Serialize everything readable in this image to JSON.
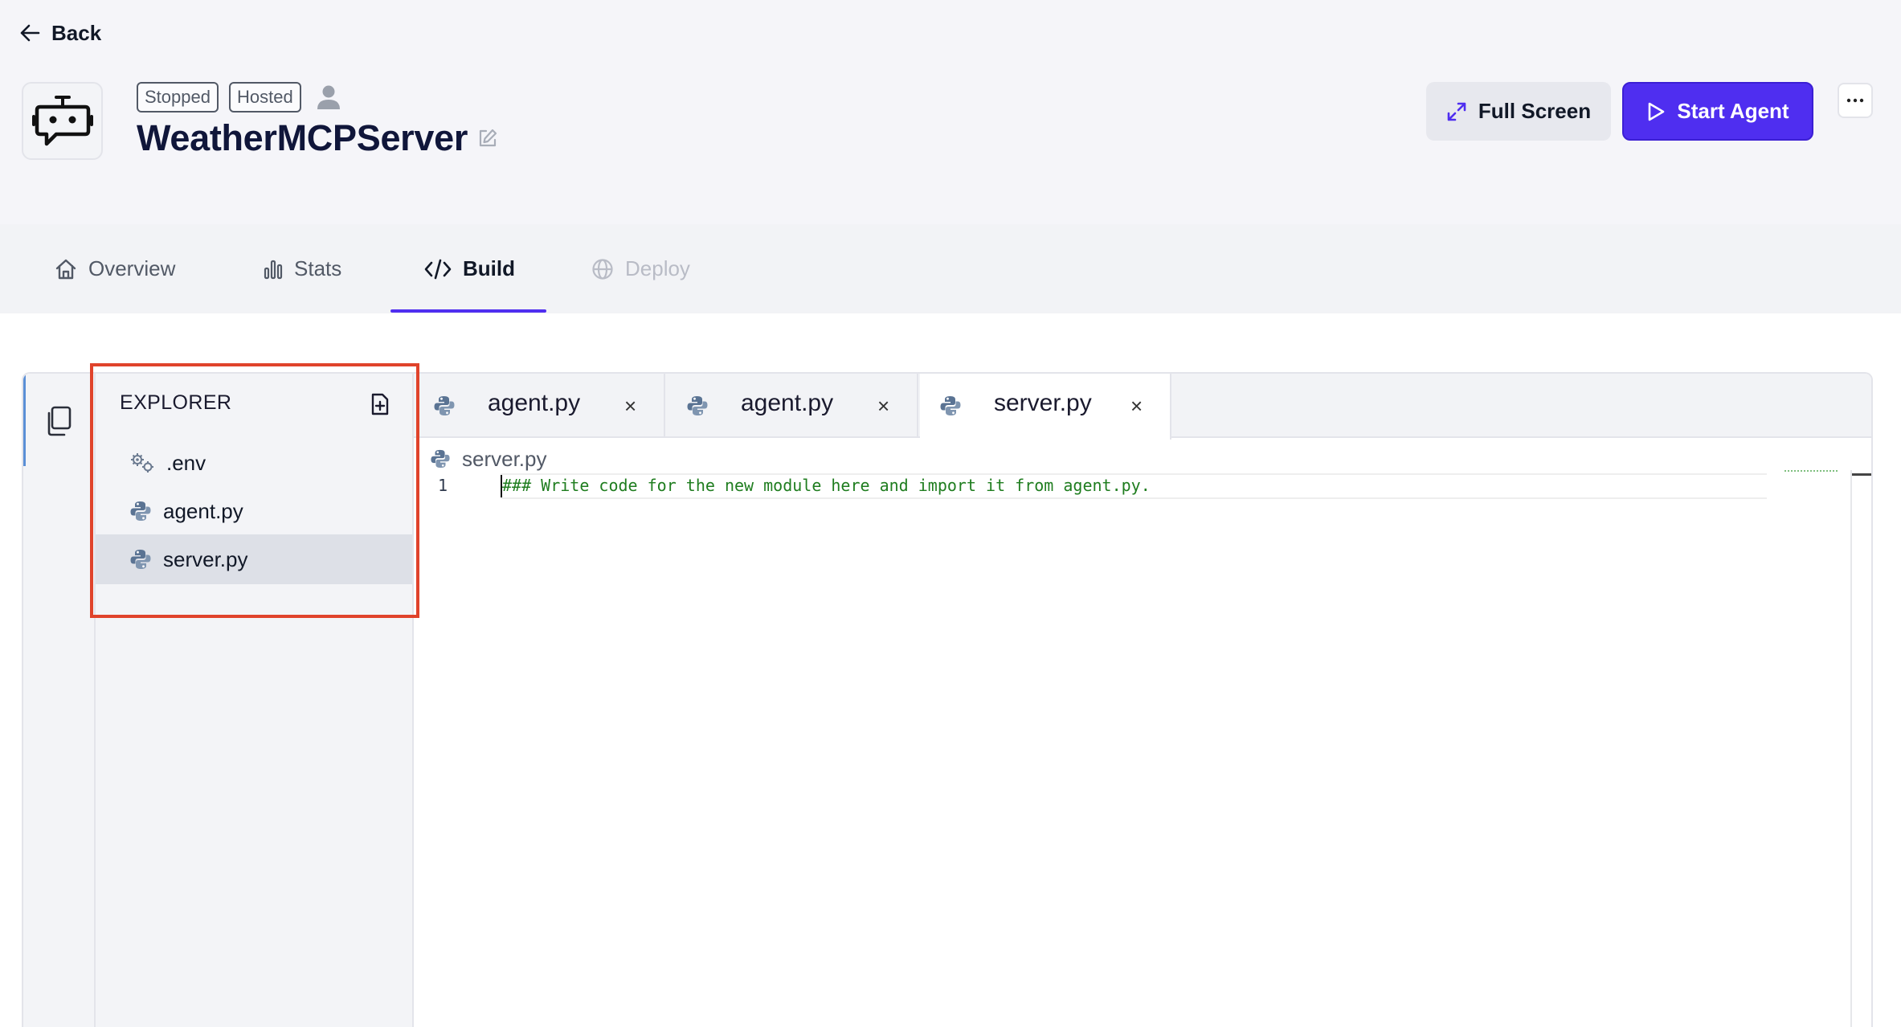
{
  "header": {
    "back_label": "Back",
    "badges": {
      "status": "Stopped",
      "hosting": "Hosted"
    },
    "agent_name": "WeatherMCPServer",
    "full_screen_label": "Full Screen",
    "start_agent_label": "Start Agent",
    "more_label": "···"
  },
  "tabs": [
    {
      "label": "Overview",
      "icon": "home-icon",
      "state": "normal"
    },
    {
      "label": "Stats",
      "icon": "bar-chart-icon",
      "state": "normal"
    },
    {
      "label": "Build",
      "icon": "code-icon",
      "state": "active"
    },
    {
      "label": "Deploy",
      "icon": "globe-icon",
      "state": "disabled"
    }
  ],
  "explorer": {
    "title": "EXPLORER",
    "files": [
      {
        "name": ".env",
        "icon": "gears-icon",
        "selected": false
      },
      {
        "name": "agent.py",
        "icon": "python-icon",
        "selected": false
      },
      {
        "name": "server.py",
        "icon": "python-icon",
        "selected": true
      }
    ]
  },
  "editor": {
    "tabs": [
      {
        "label": "agent.py",
        "active": false
      },
      {
        "label": "agent.py",
        "active": false
      },
      {
        "label": "server.py",
        "active": true
      }
    ],
    "close_glyph": "×",
    "breadcrumb": "server.py",
    "lines": [
      {
        "number": "1",
        "text": "### Write code for the new module here and import it from agent.py."
      }
    ]
  },
  "colors": {
    "accent": "#4f2ef0",
    "highlight_box": "#e0432b",
    "comment_green": "#1f7d1f"
  }
}
